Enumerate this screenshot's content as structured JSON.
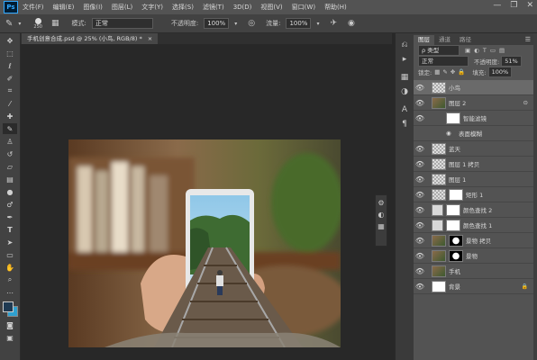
{
  "app": {
    "logo": "Ps"
  },
  "menu": [
    "文件(F)",
    "编辑(E)",
    "图像(I)",
    "图层(L)",
    "文字(Y)",
    "选择(S)",
    "滤镜(T)",
    "3D(D)",
    "视图(V)",
    "窗口(W)",
    "帮助(H)"
  ],
  "window_controls": [
    "—",
    "❐",
    "✕"
  ],
  "options": {
    "brush_size": "250",
    "mode_label": "模式:",
    "mode_value": "正常",
    "opacity_label": "不透明度:",
    "opacity_value": "100%",
    "flow_label": "流量:",
    "flow_value": "100%"
  },
  "document": {
    "tab_title": "手机创意合成.psd @ 25% (小鸟, RGB/8) *",
    "close": "×"
  },
  "panel": {
    "tabs": [
      "图层",
      "通道",
      "路径"
    ],
    "filter_kind": "ρ 类型",
    "blend_mode": "正常",
    "opacity_label": "不透明度:",
    "opacity_value": "51%",
    "lock_label": "锁定:",
    "fill_label": "填充:",
    "fill_value": "100%",
    "menu_icon": "☰"
  },
  "layers": [
    {
      "name": "小鸟",
      "selected": true,
      "thumb": "checker"
    },
    {
      "name": "图层 2",
      "thumb": "photo",
      "fx": "⊙"
    },
    {
      "name": "智能滤镜",
      "sub": true,
      "thumb": "white"
    },
    {
      "name": "表面模糊",
      "sub": true,
      "filter": true
    },
    {
      "name": "蓝天",
      "thumb": "checker"
    },
    {
      "name": "图层 1 拷贝",
      "thumb": "checker"
    },
    {
      "name": "图层 1",
      "thumb": "checker"
    },
    {
      "name": "矩形 1",
      "thumb": "checker",
      "mask": true
    },
    {
      "name": "颜色查找 2",
      "thumb": "adj",
      "mask": true
    },
    {
      "name": "颜色查找 1",
      "thumb": "adj",
      "mask": true
    },
    {
      "name": "景物 拷贝",
      "thumb": "photo",
      "mask": true
    },
    {
      "name": "景物",
      "thumb": "photo",
      "mask": true
    },
    {
      "name": "手机",
      "thumb": "photo"
    },
    {
      "name": "背景",
      "thumb": "white",
      "lock": "🔒"
    }
  ],
  "colors": {
    "menubar": "#535353",
    "options": "#424242",
    "workspace": "#282828",
    "panel": "#535353",
    "selected_layer": "#6a6a6a",
    "fg_swatch": "#1f3a52",
    "bg_swatch": "#2fa0cf"
  }
}
